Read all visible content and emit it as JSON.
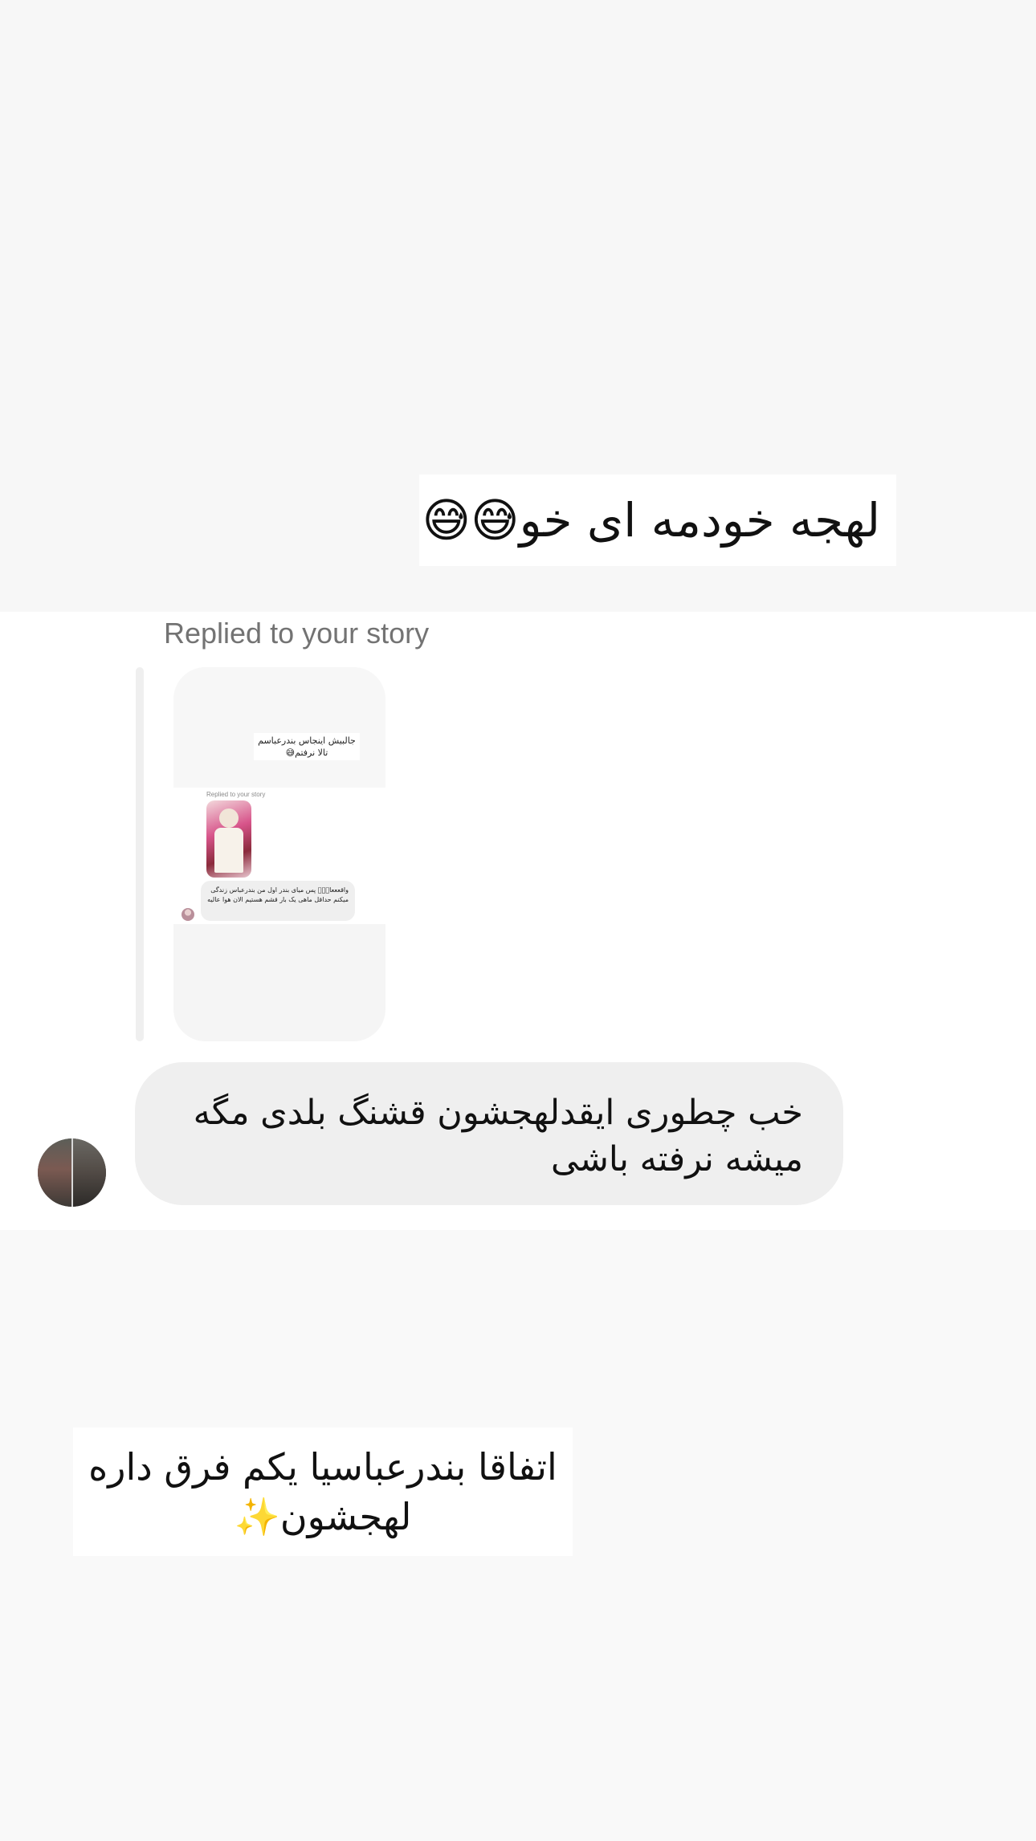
{
  "story_sticker_top": "لهجه خودمه ای خو😅😅",
  "reply_section": {
    "replied_label": "Replied to your story",
    "story_preview": {
      "sticker_text": "جالبیش اینجاس بندرعباسم تالا نرفتم😅",
      "replied_label": "Replied to your story",
      "bubble_text": "واقعععا🏻🏻🏻 پس میای بندر اول من بندرعباس زندگی میکنم حداقل ماهی یک بار قشم هستیم الان هوا عالیه"
    }
  },
  "message": {
    "text": "خب چطوری ایقدلهجشون قشنگ بلدی مگه میشه نرفته باشی"
  },
  "story_sticker_bottom": "اتفاقا بندرعباسیا یکم فرق داره لهجشون✨",
  "colors": {
    "page_background": "#f9f9f9",
    "dm_background": "#ffffff",
    "bubble_background": "#efefef",
    "muted_text": "#737373"
  }
}
